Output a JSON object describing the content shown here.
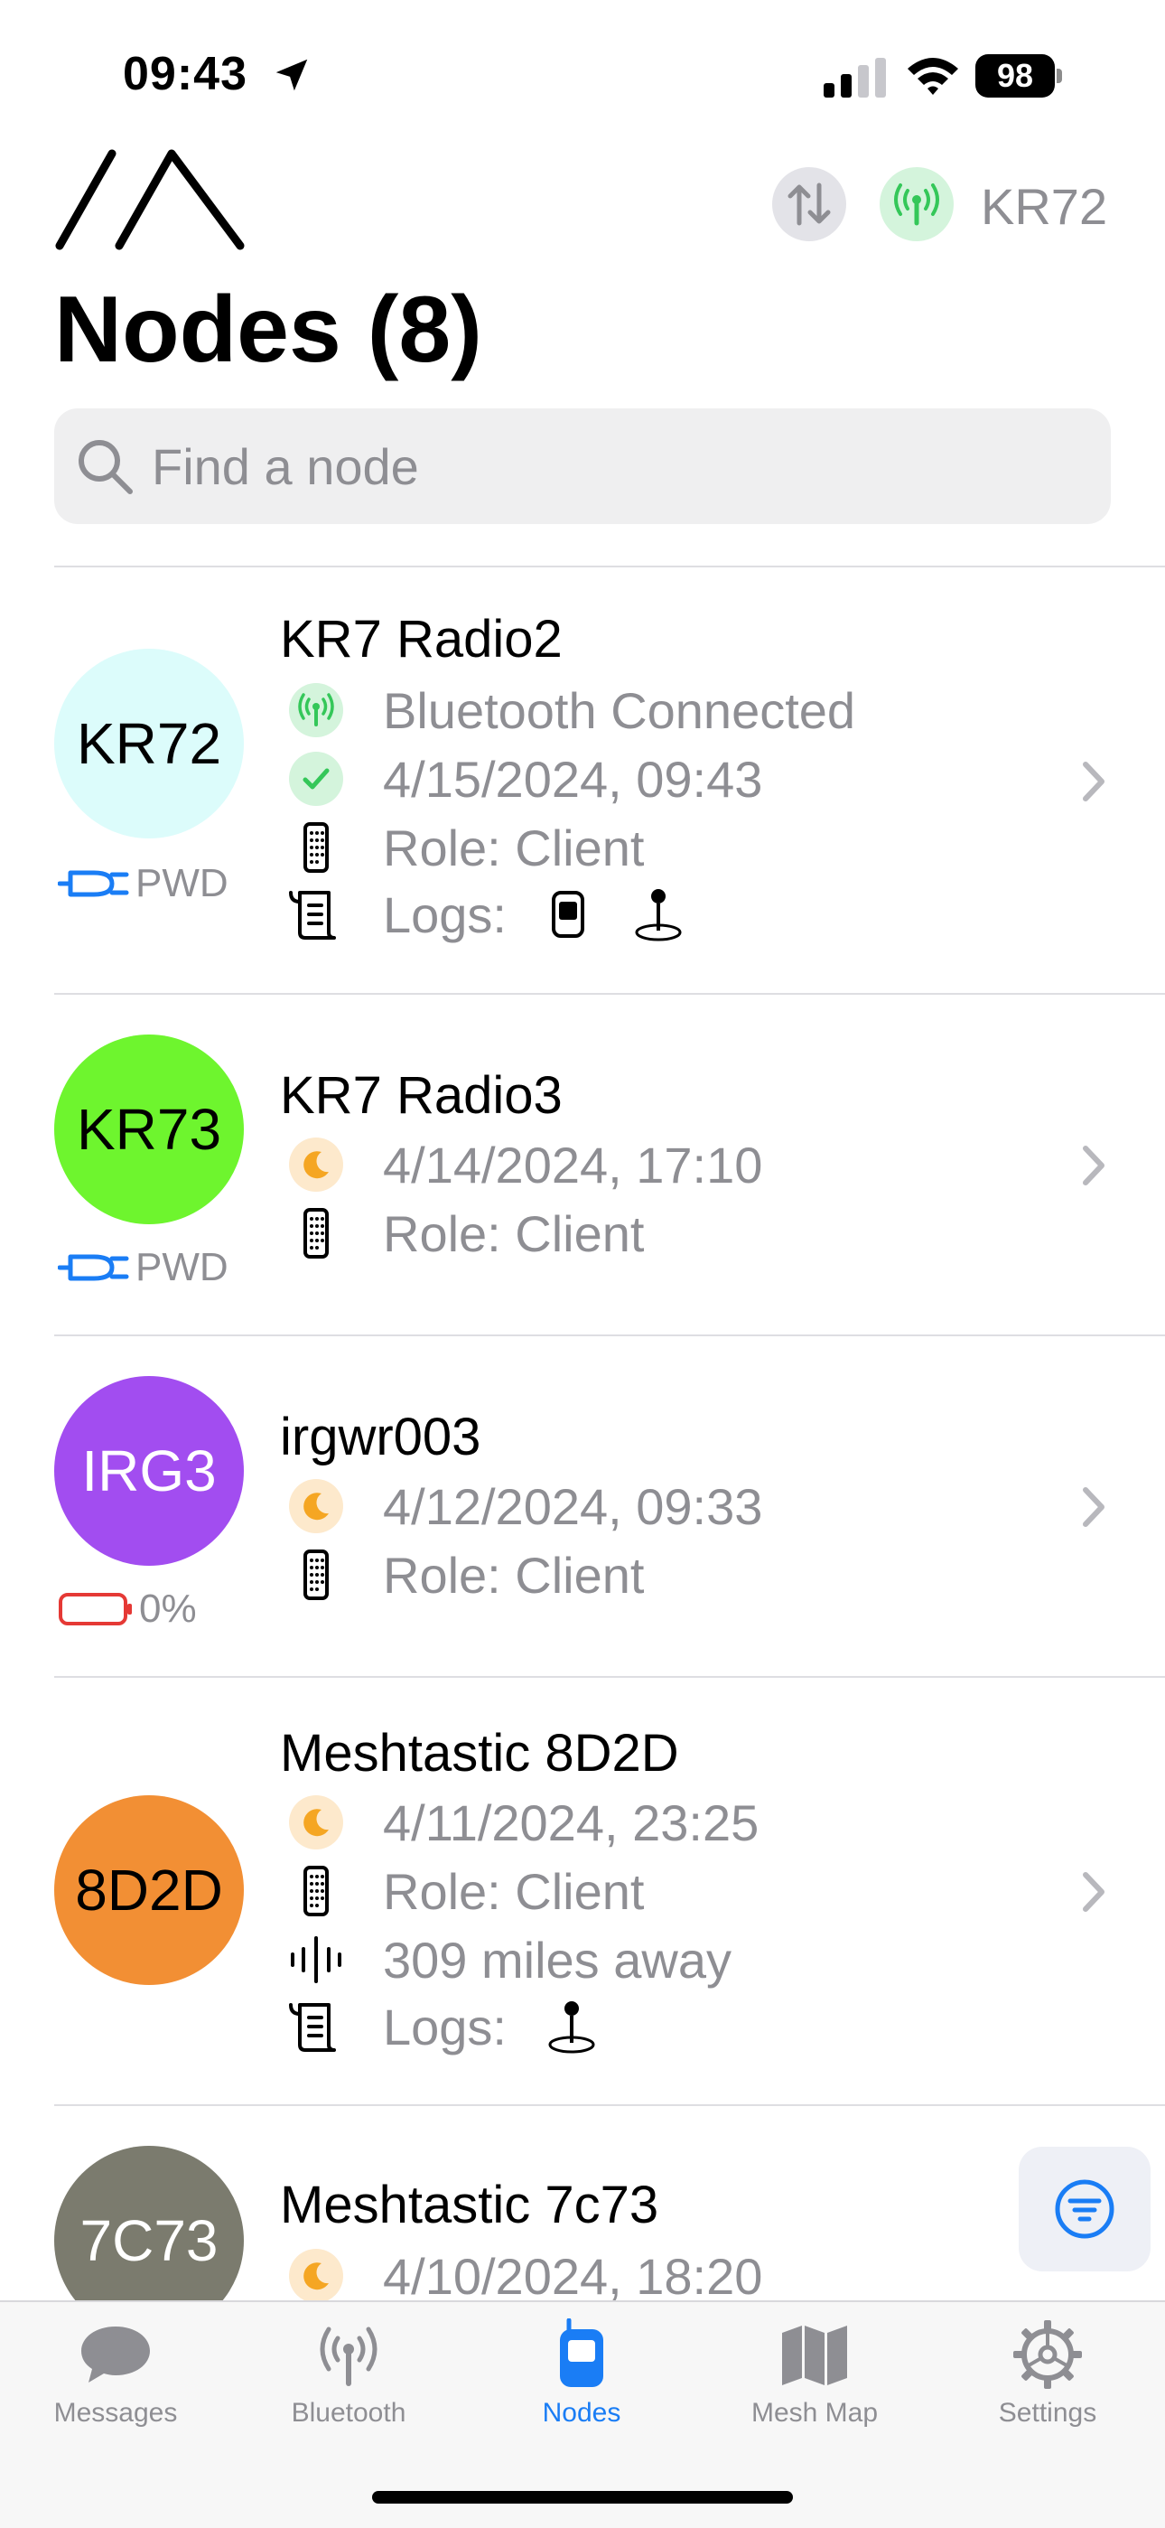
{
  "status_bar": {
    "time": "09:43",
    "battery": "98"
  },
  "header": {
    "connected_node": "KR72",
    "title": "Nodes (8)"
  },
  "search": {
    "placeholder": "Find a node",
    "value": ""
  },
  "nodes": [
    {
      "short": "KR72",
      "name": "KR7 Radio2",
      "avatar_color": "#dcfcfb",
      "avatar_text_color": "#000000",
      "power": "PWD",
      "connection": "Bluetooth Connected",
      "last_heard": "4/15/2024, 09:43",
      "role": "Role: Client",
      "logs_label": "Logs:"
    },
    {
      "short": "KR73",
      "name": "KR7 Radio3",
      "avatar_color": "#6ef52e",
      "avatar_text_color": "#000000",
      "power": "PWD",
      "last_heard": "4/14/2024, 17:10",
      "role": "Role: Client"
    },
    {
      "short": "IRG3",
      "name": "irgwr003",
      "avatar_color": "#a24df0",
      "avatar_text_color": "#ffffff",
      "battery": "0%",
      "last_heard": "4/12/2024, 09:33",
      "role": "Role: Client"
    },
    {
      "short": "8D2D",
      "name": "Meshtastic 8D2D",
      "avatar_color": "#f28f34",
      "avatar_text_color": "#000000",
      "last_heard": "4/11/2024, 23:25",
      "role": "Role: Client",
      "distance": "309 miles away",
      "logs_label": "Logs:"
    },
    {
      "short": "7C73",
      "name": "Meshtastic 7c73",
      "avatar_color": "#7b7b6e",
      "avatar_text_color": "#ffffff",
      "last_heard": "4/10/2024, 18:20"
    }
  ],
  "tabs": [
    {
      "label": "Messages",
      "icon": "chat-bubble-icon"
    },
    {
      "label": "Bluetooth",
      "icon": "antenna-icon"
    },
    {
      "label": "Nodes",
      "icon": "radio-device-icon",
      "active": true
    },
    {
      "label": "Mesh Map",
      "icon": "map-icon"
    },
    {
      "label": "Settings",
      "icon": "gear-icon"
    }
  ],
  "colors": {
    "accent": "#1a7df5",
    "connected_green": "#34c759",
    "idle_orange": "#f5a623",
    "battery_red": "#e53935",
    "secondary_text": "#8e8e93"
  }
}
